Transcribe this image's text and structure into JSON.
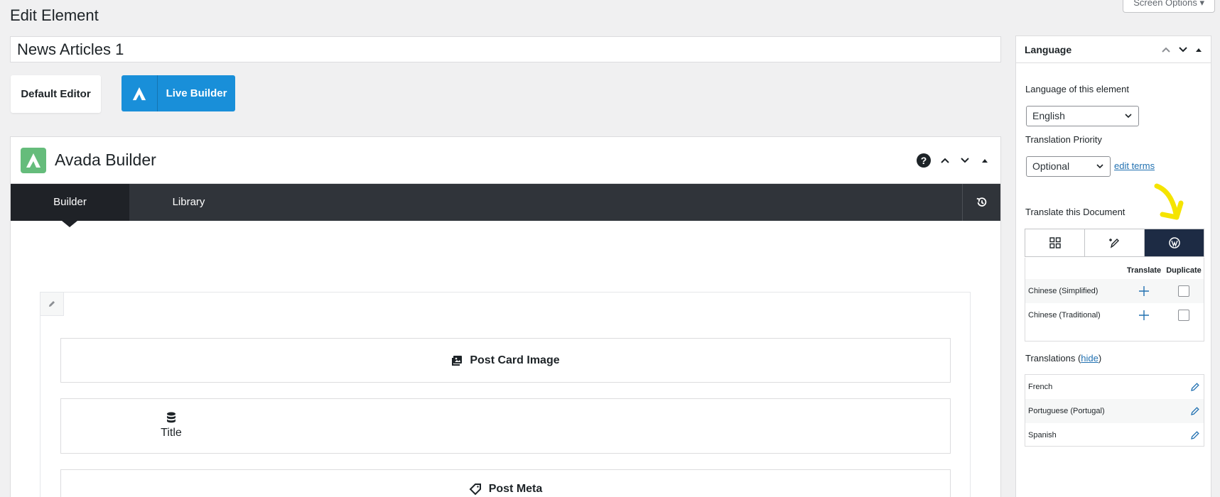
{
  "page_title": "Edit Element",
  "screen_options": "Screen Options ▾",
  "title_value": "News Articles 1",
  "buttons": {
    "default_editor": "Default Editor",
    "live_builder": "Live Builder"
  },
  "builder": {
    "title": "Avada Builder",
    "help": "?",
    "tabs": [
      {
        "label": "Builder"
      },
      {
        "label": "Library"
      }
    ],
    "elements": [
      {
        "label": "Post Card Image",
        "icon": "image-icon"
      },
      {
        "label": "Title",
        "icon": "database-icon"
      },
      {
        "label": "Post Meta",
        "icon": "tag-icon"
      }
    ]
  },
  "language_box": {
    "title": "Language",
    "lang_label": "Language of this element",
    "lang_value": "English",
    "priority_label": "Translation Priority",
    "priority_value": "Optional",
    "edit_terms": "edit terms",
    "translate_doc_label": "Translate this Document",
    "col_translate": "Translate",
    "col_duplicate": "Duplicate",
    "translate_rows": [
      "Chinese (Simplified)",
      "Chinese (Traditional)"
    ],
    "translations_label": "Translations (",
    "hide_link": "hide",
    "translations_close": ")",
    "translations": [
      "French",
      "Portuguese (Portugal)",
      "Spanish"
    ]
  },
  "colors": {
    "accent": "#198fd9",
    "avada_green": "#65bc7b",
    "nav_dark": "#30343a",
    "wp_navy": "#1d2b44",
    "link": "#2271b1",
    "arrow_yellow": "#f5e400"
  }
}
